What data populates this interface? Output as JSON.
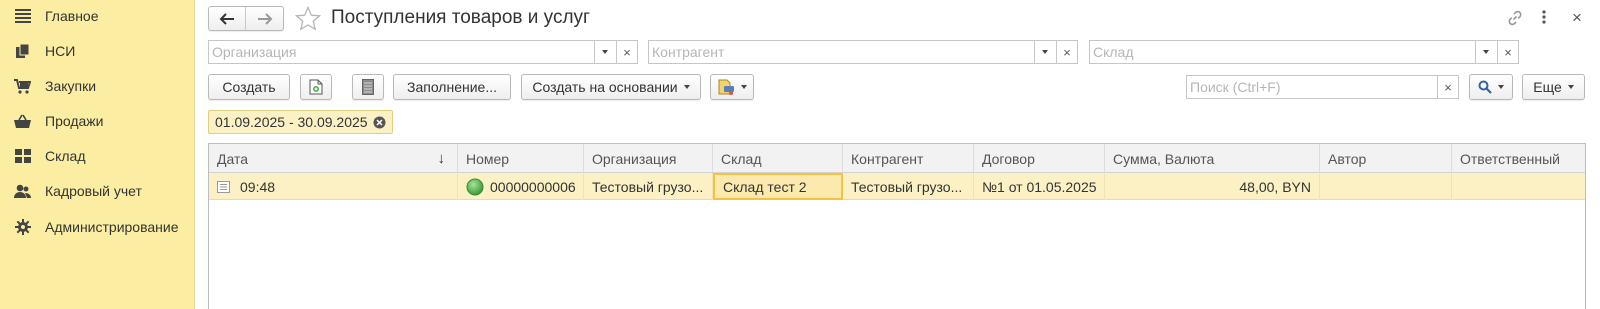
{
  "sidebar": {
    "items": [
      {
        "label": "Главное",
        "icon": "menu-icon"
      },
      {
        "label": "НСИ",
        "icon": "reference-books-icon"
      },
      {
        "label": "Закупки",
        "icon": "cart-icon"
      },
      {
        "label": "Продажи",
        "icon": "basket-icon"
      },
      {
        "label": "Склад",
        "icon": "warehouse-grid-icon"
      },
      {
        "label": "Кадровый учет",
        "icon": "people-icon"
      },
      {
        "label": "Администрирование",
        "icon": "gear-icon"
      }
    ]
  },
  "header": {
    "title": "Поступления товаров и услуг",
    "back_symbol": "🡐",
    "forward_symbol": "🡒",
    "star_symbol": "☆",
    "link_symbol": "🔗",
    "more_symbol": "⋮",
    "close_symbol": "×"
  },
  "filters": {
    "organization_placeholder": "Организация",
    "counterparty_placeholder": "Контрагент",
    "warehouse_placeholder": "Склад"
  },
  "toolbar": {
    "create_label": "Создать",
    "fill_label": "Заполнение...",
    "create_based_label": "Создать на основании",
    "search_placeholder": "Поиск (Ctrl+F)",
    "more_label": "Еще",
    "clear_symbol": "×"
  },
  "period": {
    "label": "01.09.2025 - 30.09.2025"
  },
  "table": {
    "columns": [
      "Дата",
      "Номер",
      "Организация",
      "Склад",
      "Контрагент",
      "Договор",
      "Сумма, Валюта",
      "Автор",
      "Ответственный"
    ],
    "sort_indicator": "↓",
    "rows": [
      {
        "date": "09:48",
        "number": "00000000006",
        "organization": "Тестовый грузо...",
        "warehouse": "Склад тест 2",
        "counterparty": "Тестовый грузо...",
        "contract": "№1 от 01.05.2025",
        "amount": "48,00, BYN",
        "author": "",
        "responsible": ""
      }
    ]
  },
  "colors": {
    "sidebar_bg": "#fbeea2",
    "row_highlight": "#fbf1c5",
    "cell_focus": "#f5c242",
    "status_green": "#56b24a"
  }
}
